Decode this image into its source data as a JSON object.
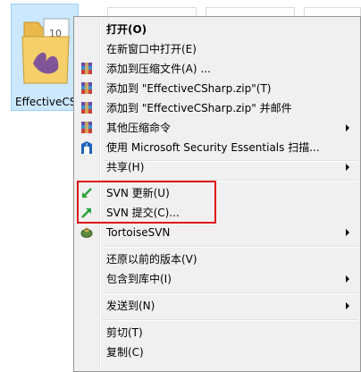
{
  "desktop": {
    "file_label": "EffectiveCS"
  },
  "menu": {
    "items": [
      {
        "label": "打开(O)",
        "bold": true,
        "icon": "none"
      },
      {
        "label": "在新窗口中打开(E)",
        "icon": "none"
      },
      {
        "label": "添加到压缩文件(A) ...",
        "icon": "winrar-archive-icon"
      },
      {
        "label": "添加到 \"EffectiveCSharp.zip\"(T)",
        "icon": "winrar-archive-icon"
      },
      {
        "label": "添加到 \"EffectiveCSharp.zip\" 并邮件",
        "icon": "winrar-archive-icon"
      },
      {
        "label": "其他压缩命令",
        "icon": "winrar-archive-icon",
        "submenu": true
      },
      {
        "label": "使用 Microsoft Security Essentials 扫描...",
        "icon": "security-essentials-icon"
      },
      {
        "label": "共享(H)",
        "icon": "none",
        "submenu": true
      },
      {
        "label": "SVN 更新(U)",
        "icon": "svn-update-icon"
      },
      {
        "label": "SVN 提交(C)...",
        "icon": "svn-commit-icon"
      },
      {
        "label": "TortoiseSVN",
        "icon": "tortoisesvn-icon",
        "submenu": true
      },
      {
        "label": "还原以前的版本(V)",
        "icon": "none"
      },
      {
        "label": "包含到库中(I)",
        "icon": "none",
        "submenu": true
      },
      {
        "label": "发送到(N)",
        "icon": "none",
        "submenu": true
      },
      {
        "label": "剪切(T)",
        "icon": "none"
      },
      {
        "label": "复制(C)",
        "icon": "none"
      }
    ]
  },
  "colors": {
    "menu_background": "#f0f0f0",
    "highlight_box": "#e0141c",
    "selection": "#cce8ff"
  }
}
